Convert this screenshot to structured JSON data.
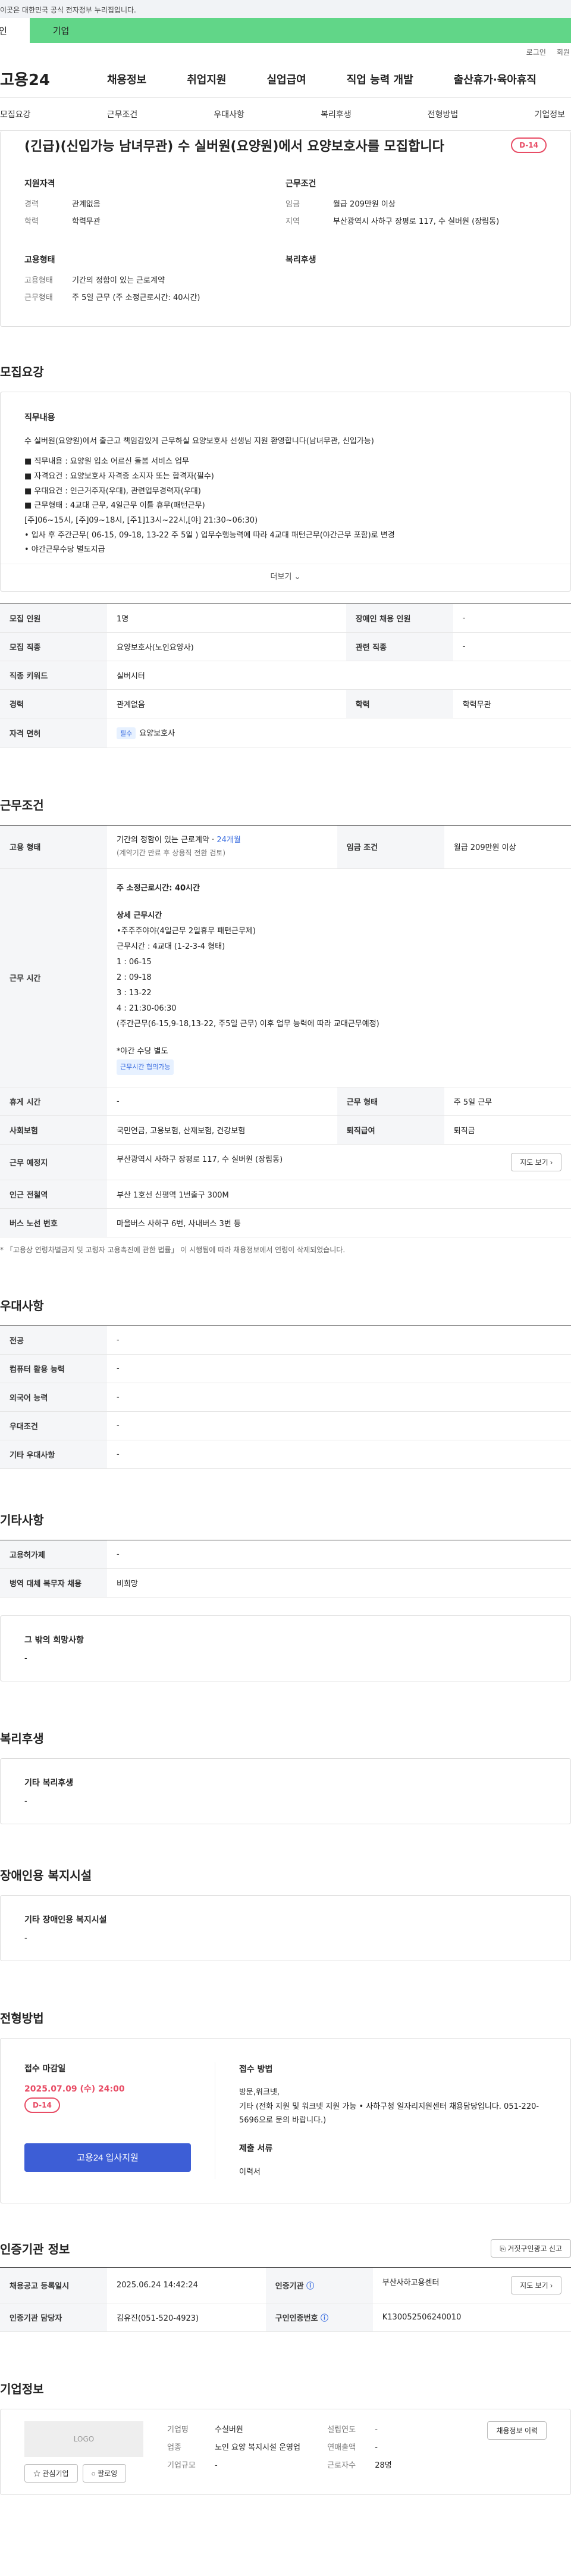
{
  "gov_notice": "이곳은 대한민국 공식 전자정부 누리집입니다.",
  "top_tabs": [
    "인",
    "기업"
  ],
  "util": [
    "로그인",
    "회원"
  ],
  "gnb": {
    "logo": "고용24",
    "items": [
      "채용정보",
      "취업지원",
      "실업급여",
      "직업 능력 개발",
      "출산휴가·육아휴직"
    ]
  },
  "subtabs": [
    "모집요강",
    "근무조건",
    "우대사항",
    "복리후생",
    "전형방법",
    "기업정보"
  ],
  "job": {
    "title": "(긴급)(신입가능 남녀무관) 수 실버원(요양원)에서 요양보호사를 모집합니다",
    "dday": "D-14",
    "qual_h": "지원자격",
    "qual": [
      [
        "경력",
        "관계없음"
      ],
      [
        "학력",
        "학력무관"
      ]
    ],
    "cond_h": "근무조건",
    "cond": [
      [
        "임금",
        "월급 209만원 이상"
      ],
      [
        "지역",
        "부산광역시 사하구 장평로 117, 수 실버원 (장림동)"
      ]
    ],
    "emp_h": "고용형태",
    "emp": [
      [
        "고용형태",
        "기간의 정함이 있는 근로계약"
      ],
      [
        "근무형태",
        "주 5일 근무 (주 소정근로시간: 40시간)"
      ]
    ],
    "welfare_h": "복리후생"
  },
  "recruit": {
    "title": "모집요강",
    "duty_h": "직무내용",
    "lines": [
      "수 실버원(요양원)에서 출근고 책임감있게 근무하실 요양보호사 선생님 지원 환영합니다(남녀무관, 신입가능)",
      "",
      "■ 직무내용 : 요양원 입소 어르신 돌봄 서비스 업무",
      "■ 자격요건 : 요양보호사 자격증 소지자 또는 합격자(필수)",
      "■ 우대요건 : 인근거주자(우대), 관련업무경력자(우대)",
      "■ 근무형태 : 4교대 근무, 4일근무 이틀 휴무(패턴근무)",
      "   [주]06~15시, [주]09~18시, [주1]13시~22시,[야] 21:30~06:30)",
      "• 입사 후 주간근무( 06-15, 09-18, 13-22 주 5일 ) 업무수행능력에 따라 4교대 패턴근무(야간근무 포함)로 변경",
      "• 야간근무수당 별도지급"
    ],
    "more": "더보기",
    "rows": [
      [
        "모집 인원",
        "1명",
        "장애인 채용 인원",
        "-"
      ],
      [
        "모집 직종",
        "요양보호사(노인요양사)",
        "관련 직종",
        "-"
      ],
      [
        "직종 키워드",
        "실버시터",
        "",
        ""
      ],
      [
        "경력",
        "관계없음",
        "학력",
        "학력무관"
      ]
    ],
    "license_k": "자격 면허",
    "license_badge": "필수",
    "license_v": "요양보호사"
  },
  "work": {
    "title": "근무조건",
    "emp_k": "고용 형태",
    "emp_v1": "기간의 정함이 있는 근로계약 ·",
    "emp_v1b": "24개월",
    "emp_v2": "(계약기간 만료 후 상용직 전환 검토)",
    "wage_k": "임금 조건",
    "wage_v": "월급 209만원 이상",
    "time_k": "근무 시간",
    "time_lines": [
      "주 소정근로시간: 40시간",
      "",
      "상세 근무시간",
      "•주주주야야(4일근무 2일휴무 패턴근무제)",
      "근무시간 : 4교대 (1-2-3-4 형태)",
      "1  :  06-15",
      "2  :  09-18",
      "3  :  13-22",
      "4  :  21:30-06:30",
      "(주간근무(6-15,9-18,13-22, 주5일 근무) 이후 업무 능력에 따라 교대근무예정)",
      "",
      "*야간 수당 별도"
    ],
    "time_badge": "근무시간 협의가능",
    "rows": [
      [
        "휴게 시간",
        "-",
        "근무 형태",
        "주 5일 근무"
      ],
      [
        "사회보험",
        "국민연금, 고용보험, 산재보험, 건강보험",
        "퇴직급여",
        "퇴직금"
      ]
    ],
    "place_k": "근무 예정지",
    "place_v": "부산광역시 사하구 장평로 117, 수 실버원 (장림동)",
    "map_btn": "지도 보기",
    "sub_k": "인근 전철역",
    "sub_v": "부산 1호선 신평역 1번출구 300M",
    "bus_k": "버스 노선 번호",
    "bus_v": "마을버스 사하구 6번, 사내버스 3번 등",
    "note": "* 「고용상 연령차별금지 및 고령자 고용촉진에 관한 법률」 이 시행됨에 따라 채용정보에서 연령이 삭제되었습니다."
  },
  "pref": {
    "title": "우대사항",
    "rows": [
      [
        "전공",
        "-"
      ],
      [
        "컴퓨터 활용 능력",
        "-"
      ],
      [
        "외국어 능력",
        "-"
      ],
      [
        "우대조건",
        "-"
      ],
      [
        "기타 우대사항",
        "-"
      ]
    ]
  },
  "etc": {
    "title": "기타사항",
    "rows": [
      [
        "고용허가제",
        "-"
      ],
      [
        "병역 대체 복무자 채용",
        "비희망"
      ]
    ],
    "hope_h": "그 밖의 희망사항",
    "hope_v": "-"
  },
  "welfare": {
    "title": "복리후생",
    "h": "기타 복리후생",
    "v": "-"
  },
  "disab": {
    "title": "장애인용 복지시설",
    "h": "기타 장애인용 복지시설",
    "v": "-"
  },
  "select": {
    "title": "전형방법",
    "deadline_h": "접수 마감일",
    "deadline_v": "2025.07.09 (수) 24:00",
    "dday": "D-14",
    "apply": "고용24 입사지원",
    "method_h": "접수 방법",
    "method_v": "방문,워크넷,",
    "method_v2": "기타 (전화 지원 및 워크넷 지원 가능  • 사하구청 일자리지원센터 채용담당입니다.  051-220-5696으로 문의 바랍니다.)",
    "doc_h": "제출 서류",
    "doc_v": "이력서"
  },
  "agency": {
    "title": "인증기관 정보",
    "report_btn": "거짓구인광고 신고",
    "r1": [
      "채용공고 등록일시",
      "2025.06.24 14:42:24",
      "인증기관",
      "부산사하고용센터"
    ],
    "map_btn": "지도 보기",
    "r2": [
      "인증기관 담당자",
      "김유진(051-520-4923)",
      "구인인증번호",
      "K130052506240010"
    ]
  },
  "company": {
    "title": "기업정보",
    "logo": "LOGO",
    "fav": "관심기업",
    "follow": "팔로잉",
    "info_btn": "채용정보 이력",
    "fields": [
      [
        "기업명",
        "수실버원"
      ],
      [
        "업종",
        "노인 요양 복지시설 운영업"
      ],
      [
        "기업규모",
        "-"
      ]
    ],
    "fields2": [
      [
        "설립연도",
        "-"
      ],
      [
        "연매출액",
        "-"
      ],
      [
        "근로자수",
        "28명"
      ]
    ]
  }
}
